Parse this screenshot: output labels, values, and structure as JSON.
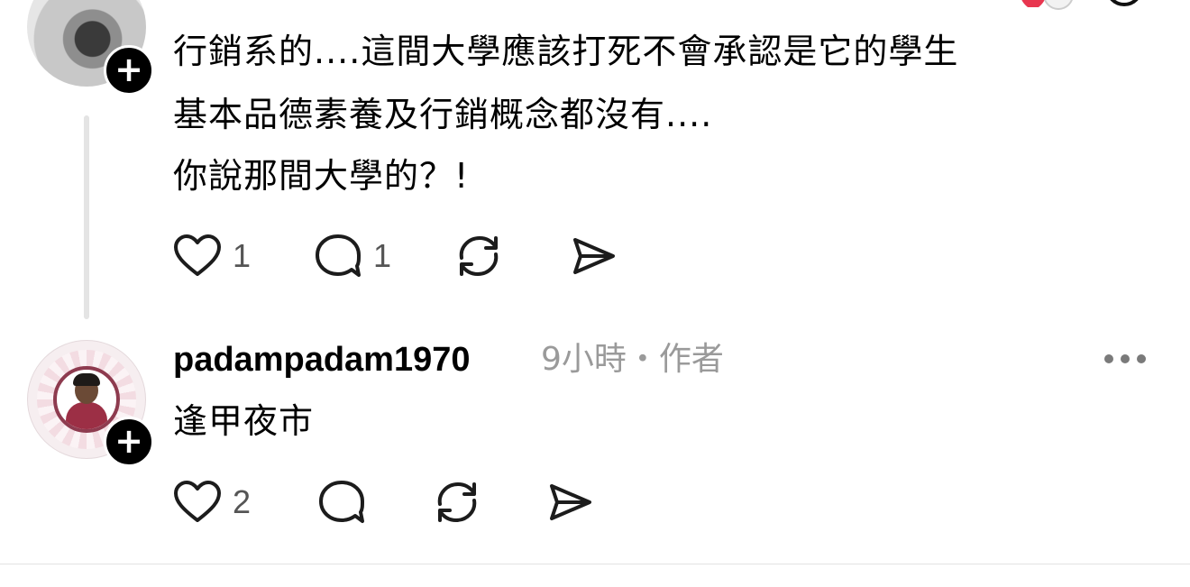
{
  "post1": {
    "lines": [
      "行銷系的....這間大學應該打死不會承認是它的學生",
      "基本品德素養及行銷概念都沒有....",
      "你說那間大學的？!"
    ],
    "like_count": "1",
    "reply_count": "1"
  },
  "post2": {
    "username": "padampadam1970",
    "meta": "9小時・作者",
    "text": "逢甲夜市",
    "like_count": "2"
  },
  "icons": {
    "like": "heart-icon",
    "reply": "comment-icon",
    "repost": "repost-icon",
    "share": "send-icon",
    "more": "more-icon",
    "follow": "plus-icon"
  },
  "colors": {
    "text": "#000000",
    "meta": "#9a9a9a",
    "icon": "#1c1c1c",
    "thread_line": "#e4e4e4"
  }
}
